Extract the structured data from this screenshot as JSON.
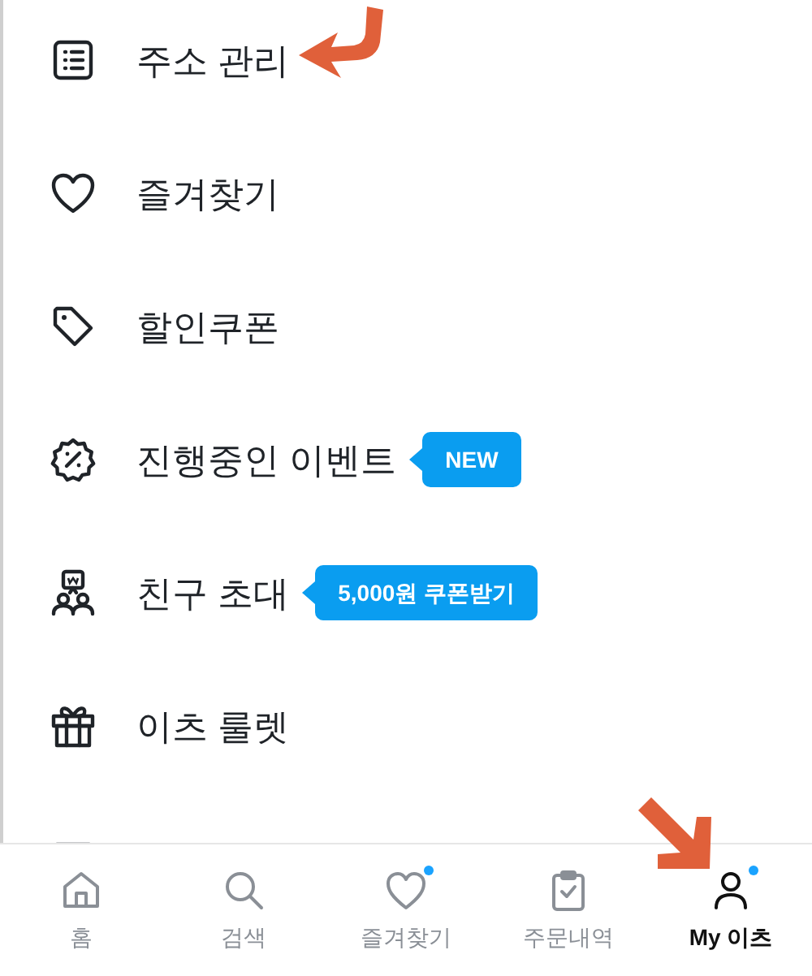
{
  "menu": [
    {
      "label": "주소 관리"
    },
    {
      "label": "즐겨찾기"
    },
    {
      "label": "할인쿠폰"
    },
    {
      "label": "진행중인 이벤트",
      "badge": "NEW"
    },
    {
      "label": "친구 초대",
      "badge": "5,000원 쿠폰받기"
    },
    {
      "label": "이츠 룰렛"
    }
  ],
  "tab_bar": [
    {
      "label": "홈",
      "selected": false,
      "dot": false
    },
    {
      "label": "검색",
      "selected": false,
      "dot": false
    },
    {
      "label": "즐겨찾기",
      "selected": false,
      "dot": true
    },
    {
      "label": "주문내역",
      "selected": false,
      "dot": false
    },
    {
      "label": "My 이츠",
      "selected": true,
      "dot": true
    }
  ]
}
